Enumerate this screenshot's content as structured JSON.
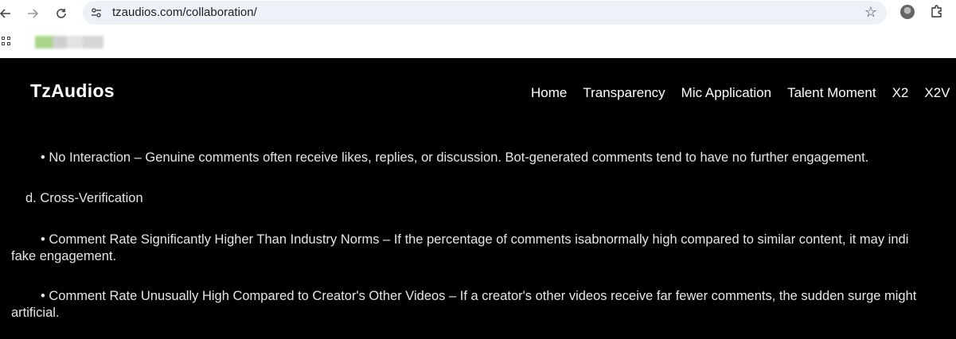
{
  "browser": {
    "url": "tzaudios.com/collaboration/",
    "back_icon": "arrow-left-icon",
    "forward_icon": "arrow-right-icon",
    "reload_icon": "reload-icon",
    "site_info_icon": "tune-icon",
    "bookmark_icon": "star-icon",
    "profile_icon": "avatar-icon",
    "extensions_icon": "puzzle-icon",
    "apps_icon": "apps-grid-icon"
  },
  "site": {
    "logo": "TzAudios",
    "nav": [
      "Home",
      "Transparency",
      "Mic Application",
      "Talent Moment",
      "X2",
      "X2V"
    ]
  },
  "content": {
    "p1": "• No Interaction – Genuine comments often receive likes, replies, or discussion. Bot-generated comments tend to have no further engagement.",
    "heading_d": "d. Cross-Verification",
    "p2_line1": "• Comment Rate Significantly Higher Than Industry Norms – If the percentage of comments isabnormally high compared to similar content, it may indi",
    "p2_line2": "fake engagement.",
    "p3_line1": "• Comment Rate Unusually High Compared to Creator's Other Videos – If a creator's other videos receive far fewer comments, the sudden surge might",
    "p3_line2": "artificial."
  }
}
